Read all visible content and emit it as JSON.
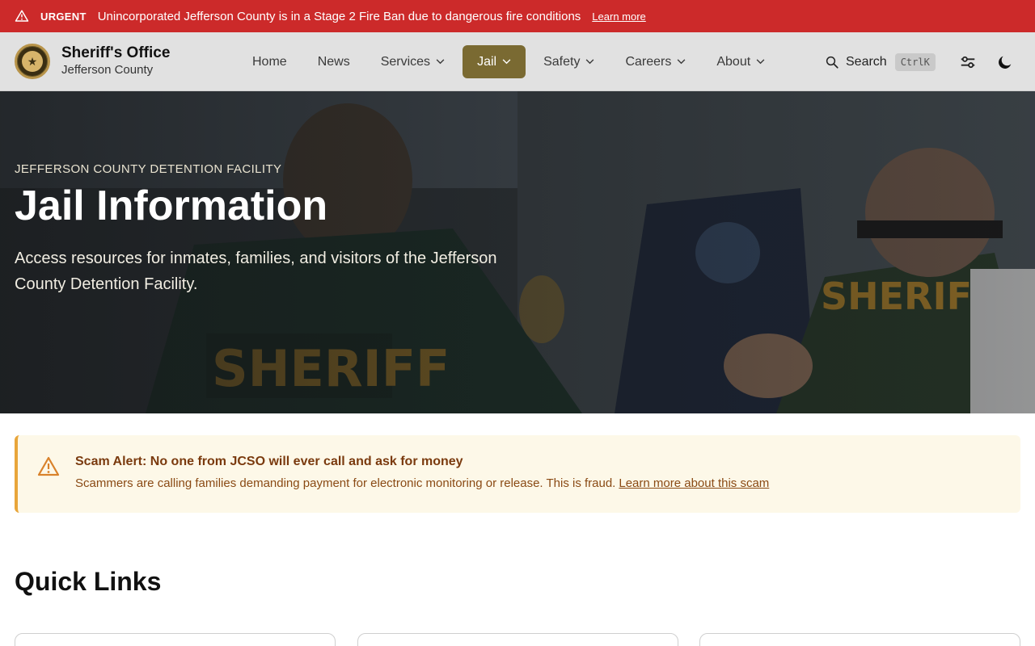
{
  "urgent_banner": {
    "tag": "URGENT",
    "message": "Unincorporated Jefferson County is in a Stage 2 Fire Ban due to dangerous fire conditions",
    "link": "Learn more",
    "icon": "warning-triangle-icon"
  },
  "header": {
    "title": "Sheriff's Office",
    "subtitle": "Jefferson County",
    "nav": [
      {
        "label": "Home",
        "dropdown": false
      },
      {
        "label": "News",
        "dropdown": false
      },
      {
        "label": "Services",
        "dropdown": true
      },
      {
        "label": "Jail",
        "dropdown": true,
        "active": true
      },
      {
        "label": "Safety",
        "dropdown": true
      },
      {
        "label": "Careers",
        "dropdown": true
      },
      {
        "label": "About",
        "dropdown": true
      }
    ],
    "search_label": "Search",
    "search_shortcut": "CtrlK"
  },
  "hero": {
    "eyebrow": "JEFFERSON COUNTY DETENTION FACILITY",
    "title": "Jail Information",
    "description": "Access resources for inmates, families, and visitors of the Jefferson County Detention Facility."
  },
  "scam_alert": {
    "title": "Scam Alert: No one from JCSO will ever call and ask for money",
    "body": "Scammers are calling families demanding payment for electronic monitoring or release. This is fraud.",
    "link": "Learn more about this scam"
  },
  "quick_links": {
    "title": "Quick Links"
  },
  "colors": {
    "urgent_red": "#cc2a2a",
    "nav_active": "#7a6a32",
    "alert_border": "#e8a53a",
    "alert_bg": "#fdf8e8"
  }
}
